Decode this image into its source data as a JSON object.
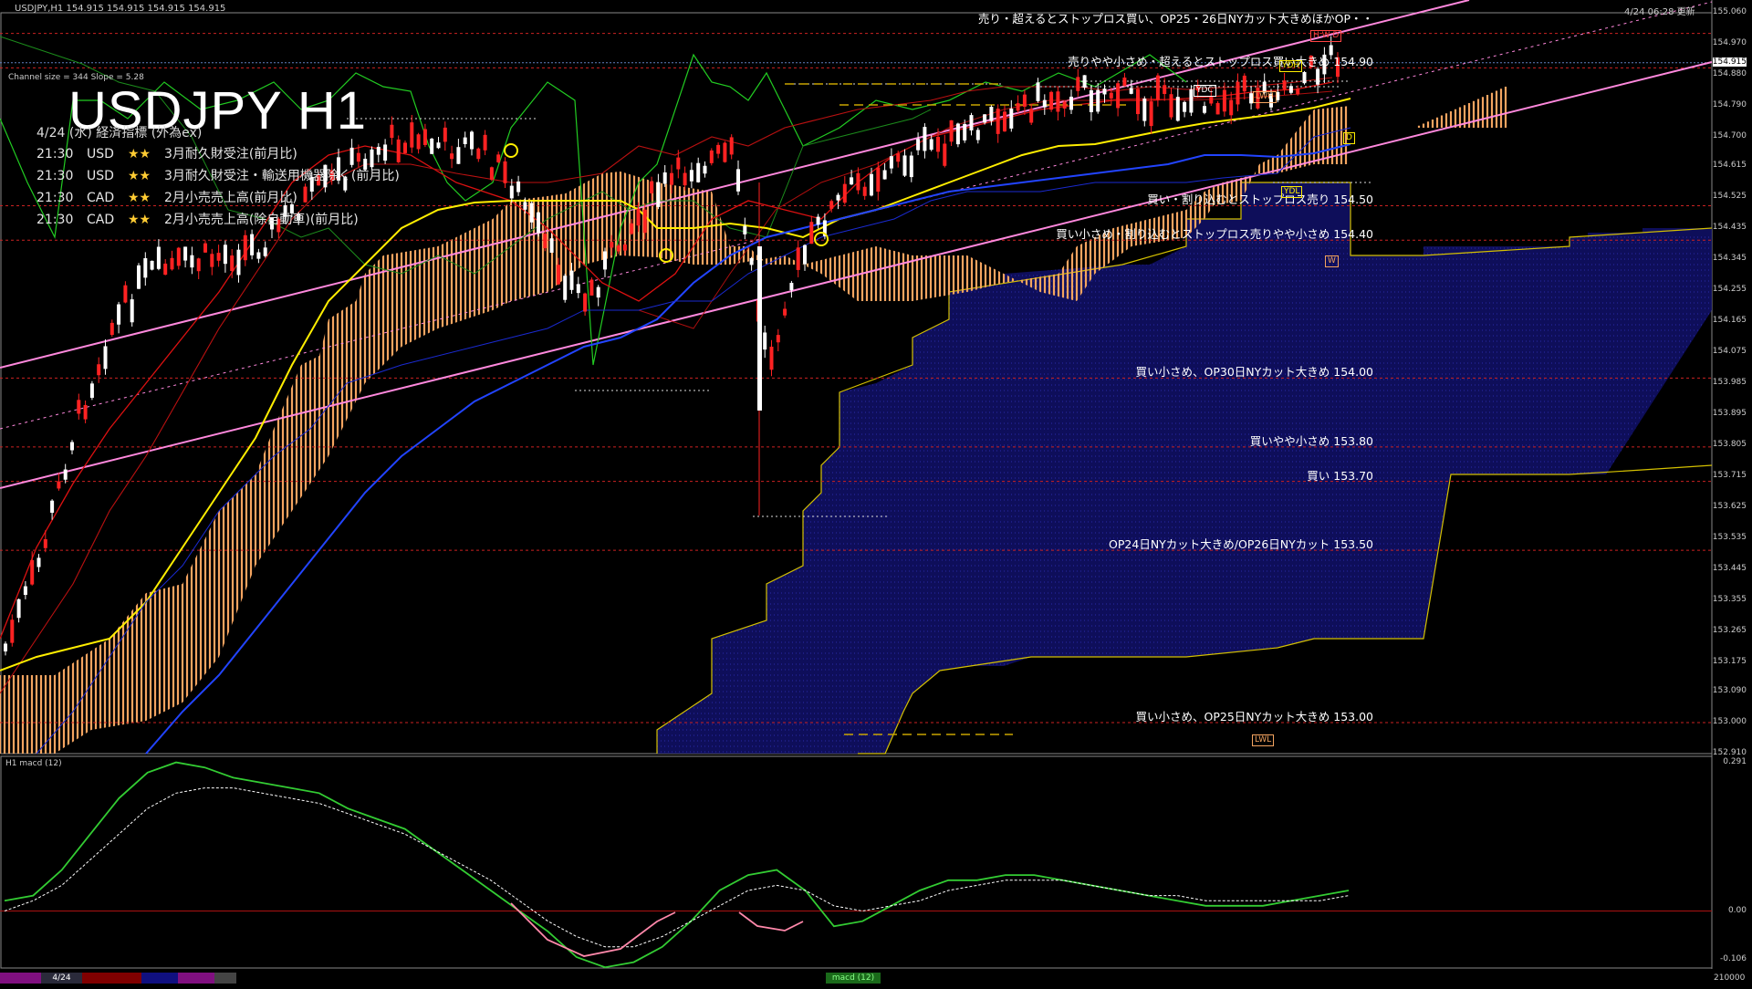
{
  "header": {
    "symbol_line": "USDJPY,H1 154.915 154.915 154.915 154.915",
    "time": "4/24 06:28 更新",
    "channel_info": "Channel size = 344 Slope = 5.28"
  },
  "chart_title": "USDJPY H1",
  "events_title": "4/24 (水) 経済指標 (外為ex)",
  "events": [
    {
      "time": "21:30",
      "currency": "USD",
      "stars": "★★",
      "name": "3月耐久財受注(前月比)"
    },
    {
      "time": "21:30",
      "currency": "USD",
      "stars": "★★",
      "name": "3月耐久財受注・輸送用機器除く(前月比)"
    },
    {
      "time": "21:30",
      "currency": "CAD",
      "stars": "★★",
      "name": "2月小売売上高(前月比)"
    },
    {
      "time": "21:30",
      "currency": "CAD",
      "stars": "★★",
      "name": "2月小売売上高(除自動車)(前月比)"
    }
  ],
  "levels": [
    {
      "label": "売り・超えるとストップロス買い、OP25・26日NYカット大きめほかOP・・",
      "price": "155.00"
    },
    {
      "label": "売りやや小さめ・超えるとストップロス買い大きめ 154.90",
      "price": "154.90"
    },
    {
      "label": "買い・割り込むとストップロス売り 154.50",
      "price": "154.50"
    },
    {
      "label": "買い小さめ・割り込むとストップロス売りやや小さめ 154.40",
      "price": "154.40"
    },
    {
      "label": "買い小さめ、OP30日NYカット大きめ 154.00",
      "price": "154.00"
    },
    {
      "label": "買いやや小さめ 153.80",
      "price": "153.80"
    },
    {
      "label": "買い 153.70",
      "price": "153.70"
    },
    {
      "label": "OP24日NYカット大きめ/OP26日NYカット 153.50",
      "price": "153.50"
    },
    {
      "label": "買い小さめ、OP25日NYカット大きめ 153.00",
      "price": "153.00"
    }
  ],
  "badges": {
    "ydh": "YDH",
    "ydc": "YDC",
    "lwh": "LWH",
    "ydl": "YDL",
    "w": "W",
    "d": "D",
    "lwl": "LWL",
    "top": "H W D"
  },
  "price_axis": [
    "155.060",
    "154.970",
    "154.915",
    "154.880",
    "154.790",
    "154.700",
    "154.615",
    "154.525",
    "154.435",
    "154.345",
    "154.255",
    "154.165",
    "154.075",
    "153.985",
    "153.895",
    "153.805",
    "153.715",
    "153.625",
    "153.535",
    "153.445",
    "153.355",
    "153.265",
    "153.175",
    "153.090",
    "153.000",
    "152.910"
  ],
  "macd": {
    "label": "H1 macd (12)",
    "axis": [
      "0.291",
      "0.00",
      "-0.106"
    ],
    "series": [
      {
        "name": "macd",
        "color": "#33cc33",
        "values": [
          0.02,
          0.03,
          0.08,
          0.15,
          0.22,
          0.27,
          0.29,
          0.28,
          0.26,
          0.25,
          0.24,
          0.23,
          0.2,
          0.18,
          0.16,
          0.12,
          0.08,
          0.04,
          0.0,
          -0.04,
          -0.09,
          -0.11,
          -0.1,
          -0.07,
          -0.02,
          0.04,
          0.07,
          0.08,
          0.04,
          -0.03,
          -0.02,
          0.01,
          0.04,
          0.06,
          0.06,
          0.07,
          0.07,
          0.06,
          0.05,
          0.04,
          0.03,
          0.02,
          0.01,
          0.01,
          0.01,
          0.02,
          0.03,
          0.04
        ]
      },
      {
        "name": "signal",
        "color": "#ffffff",
        "values": [
          0.0,
          0.02,
          0.05,
          0.1,
          0.15,
          0.2,
          0.23,
          0.24,
          0.24,
          0.23,
          0.22,
          0.21,
          0.19,
          0.17,
          0.15,
          0.12,
          0.09,
          0.06,
          0.02,
          -0.02,
          -0.05,
          -0.07,
          -0.07,
          -0.05,
          -0.02,
          0.01,
          0.04,
          0.05,
          0.04,
          0.01,
          0.0,
          0.01,
          0.02,
          0.04,
          0.05,
          0.06,
          0.06,
          0.06,
          0.05,
          0.04,
          0.03,
          0.03,
          0.02,
          0.02,
          0.02,
          0.02,
          0.02,
          0.03
        ]
      }
    ]
  },
  "bottom": {
    "date": "4/24",
    "macd_tag": "macd (12)",
    "right": "210000"
  },
  "colors": {
    "bg": "#000000",
    "bull": "#ffffff",
    "bear": "#ff2222",
    "kumo": "#f4a460",
    "blue_kumo": "#1a1a8a",
    "pink": "#ff88dd",
    "yellow": "#ffee00",
    "blue": "#2244ff",
    "green": "#22cc22"
  }
}
